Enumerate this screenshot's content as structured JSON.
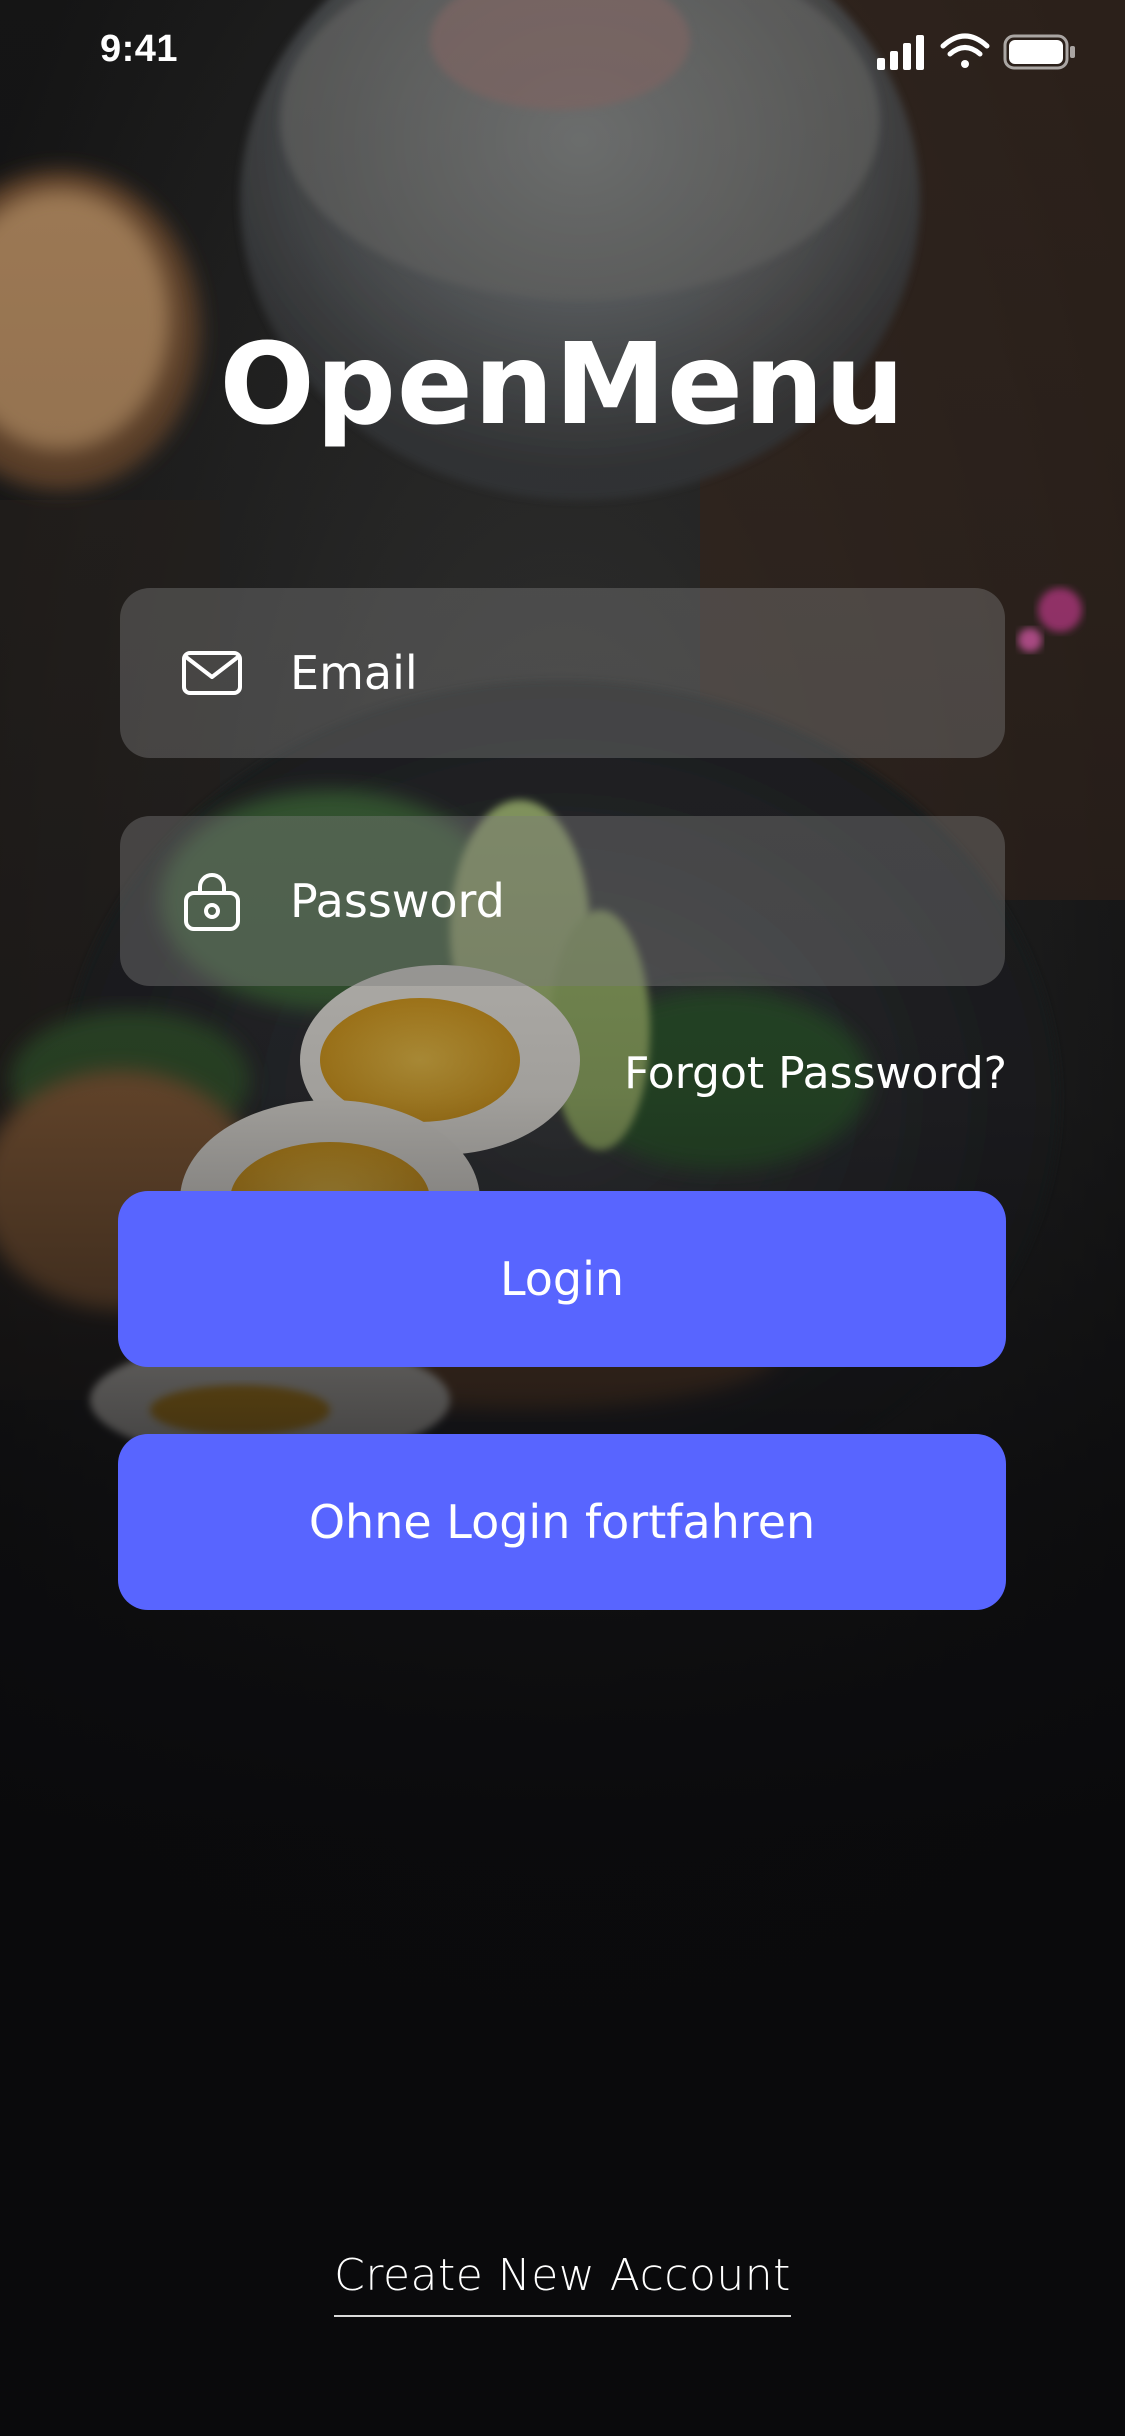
{
  "status_bar": {
    "time": "9:41",
    "icons": [
      "cellular-signal-icon",
      "wifi-icon",
      "battery-icon"
    ]
  },
  "app": {
    "title": "OpenMenu"
  },
  "form": {
    "email": {
      "placeholder": "Email",
      "value": "",
      "icon": "envelope-icon"
    },
    "password": {
      "placeholder": "Password",
      "value": "",
      "icon": "lock-icon"
    },
    "forgot_password_label": "Forgot Password?",
    "login_label": "Login",
    "guest_label": "Ohne Login fortfahren"
  },
  "footer": {
    "create_account_label": "Create New Account"
  },
  "colors": {
    "accent": "#5865ff",
    "field_background": "rgba(125,125,125,0.42)",
    "text": "#ffffff",
    "background": "#0d0d0e"
  }
}
